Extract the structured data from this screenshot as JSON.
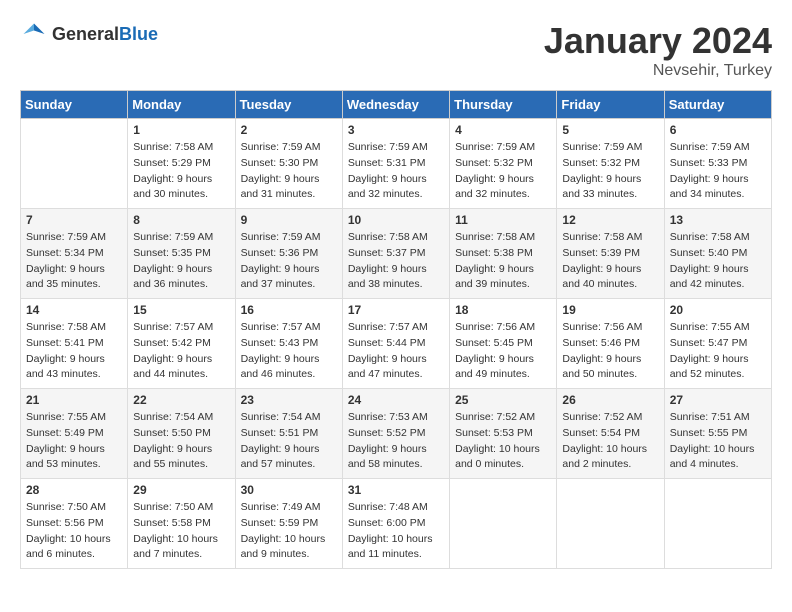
{
  "logo": {
    "general": "General",
    "blue": "Blue"
  },
  "header": {
    "month": "January 2024",
    "location": "Nevsehir, Turkey"
  },
  "weekdays": [
    "Sunday",
    "Monday",
    "Tuesday",
    "Wednesday",
    "Thursday",
    "Friday",
    "Saturday"
  ],
  "weeks": [
    [
      {
        "day": "",
        "sunrise": "",
        "sunset": "",
        "daylight": ""
      },
      {
        "day": "1",
        "sunrise": "Sunrise: 7:58 AM",
        "sunset": "Sunset: 5:29 PM",
        "daylight": "Daylight: 9 hours and 30 minutes."
      },
      {
        "day": "2",
        "sunrise": "Sunrise: 7:59 AM",
        "sunset": "Sunset: 5:30 PM",
        "daylight": "Daylight: 9 hours and 31 minutes."
      },
      {
        "day": "3",
        "sunrise": "Sunrise: 7:59 AM",
        "sunset": "Sunset: 5:31 PM",
        "daylight": "Daylight: 9 hours and 32 minutes."
      },
      {
        "day": "4",
        "sunrise": "Sunrise: 7:59 AM",
        "sunset": "Sunset: 5:32 PM",
        "daylight": "Daylight: 9 hours and 32 minutes."
      },
      {
        "day": "5",
        "sunrise": "Sunrise: 7:59 AM",
        "sunset": "Sunset: 5:32 PM",
        "daylight": "Daylight: 9 hours and 33 minutes."
      },
      {
        "day": "6",
        "sunrise": "Sunrise: 7:59 AM",
        "sunset": "Sunset: 5:33 PM",
        "daylight": "Daylight: 9 hours and 34 minutes."
      }
    ],
    [
      {
        "day": "7",
        "sunrise": "Sunrise: 7:59 AM",
        "sunset": "Sunset: 5:34 PM",
        "daylight": "Daylight: 9 hours and 35 minutes."
      },
      {
        "day": "8",
        "sunrise": "Sunrise: 7:59 AM",
        "sunset": "Sunset: 5:35 PM",
        "daylight": "Daylight: 9 hours and 36 minutes."
      },
      {
        "day": "9",
        "sunrise": "Sunrise: 7:59 AM",
        "sunset": "Sunset: 5:36 PM",
        "daylight": "Daylight: 9 hours and 37 minutes."
      },
      {
        "day": "10",
        "sunrise": "Sunrise: 7:58 AM",
        "sunset": "Sunset: 5:37 PM",
        "daylight": "Daylight: 9 hours and 38 minutes."
      },
      {
        "day": "11",
        "sunrise": "Sunrise: 7:58 AM",
        "sunset": "Sunset: 5:38 PM",
        "daylight": "Daylight: 9 hours and 39 minutes."
      },
      {
        "day": "12",
        "sunrise": "Sunrise: 7:58 AM",
        "sunset": "Sunset: 5:39 PM",
        "daylight": "Daylight: 9 hours and 40 minutes."
      },
      {
        "day": "13",
        "sunrise": "Sunrise: 7:58 AM",
        "sunset": "Sunset: 5:40 PM",
        "daylight": "Daylight: 9 hours and 42 minutes."
      }
    ],
    [
      {
        "day": "14",
        "sunrise": "Sunrise: 7:58 AM",
        "sunset": "Sunset: 5:41 PM",
        "daylight": "Daylight: 9 hours and 43 minutes."
      },
      {
        "day": "15",
        "sunrise": "Sunrise: 7:57 AM",
        "sunset": "Sunset: 5:42 PM",
        "daylight": "Daylight: 9 hours and 44 minutes."
      },
      {
        "day": "16",
        "sunrise": "Sunrise: 7:57 AM",
        "sunset": "Sunset: 5:43 PM",
        "daylight": "Daylight: 9 hours and 46 minutes."
      },
      {
        "day": "17",
        "sunrise": "Sunrise: 7:57 AM",
        "sunset": "Sunset: 5:44 PM",
        "daylight": "Daylight: 9 hours and 47 minutes."
      },
      {
        "day": "18",
        "sunrise": "Sunrise: 7:56 AM",
        "sunset": "Sunset: 5:45 PM",
        "daylight": "Daylight: 9 hours and 49 minutes."
      },
      {
        "day": "19",
        "sunrise": "Sunrise: 7:56 AM",
        "sunset": "Sunset: 5:46 PM",
        "daylight": "Daylight: 9 hours and 50 minutes."
      },
      {
        "day": "20",
        "sunrise": "Sunrise: 7:55 AM",
        "sunset": "Sunset: 5:47 PM",
        "daylight": "Daylight: 9 hours and 52 minutes."
      }
    ],
    [
      {
        "day": "21",
        "sunrise": "Sunrise: 7:55 AM",
        "sunset": "Sunset: 5:49 PM",
        "daylight": "Daylight: 9 hours and 53 minutes."
      },
      {
        "day": "22",
        "sunrise": "Sunrise: 7:54 AM",
        "sunset": "Sunset: 5:50 PM",
        "daylight": "Daylight: 9 hours and 55 minutes."
      },
      {
        "day": "23",
        "sunrise": "Sunrise: 7:54 AM",
        "sunset": "Sunset: 5:51 PM",
        "daylight": "Daylight: 9 hours and 57 minutes."
      },
      {
        "day": "24",
        "sunrise": "Sunrise: 7:53 AM",
        "sunset": "Sunset: 5:52 PM",
        "daylight": "Daylight: 9 hours and 58 minutes."
      },
      {
        "day": "25",
        "sunrise": "Sunrise: 7:52 AM",
        "sunset": "Sunset: 5:53 PM",
        "daylight": "Daylight: 10 hours and 0 minutes."
      },
      {
        "day": "26",
        "sunrise": "Sunrise: 7:52 AM",
        "sunset": "Sunset: 5:54 PM",
        "daylight": "Daylight: 10 hours and 2 minutes."
      },
      {
        "day": "27",
        "sunrise": "Sunrise: 7:51 AM",
        "sunset": "Sunset: 5:55 PM",
        "daylight": "Daylight: 10 hours and 4 minutes."
      }
    ],
    [
      {
        "day": "28",
        "sunrise": "Sunrise: 7:50 AM",
        "sunset": "Sunset: 5:56 PM",
        "daylight": "Daylight: 10 hours and 6 minutes."
      },
      {
        "day": "29",
        "sunrise": "Sunrise: 7:50 AM",
        "sunset": "Sunset: 5:58 PM",
        "daylight": "Daylight: 10 hours and 7 minutes."
      },
      {
        "day": "30",
        "sunrise": "Sunrise: 7:49 AM",
        "sunset": "Sunset: 5:59 PM",
        "daylight": "Daylight: 10 hours and 9 minutes."
      },
      {
        "day": "31",
        "sunrise": "Sunrise: 7:48 AM",
        "sunset": "Sunset: 6:00 PM",
        "daylight": "Daylight: 10 hours and 11 minutes."
      },
      {
        "day": "",
        "sunrise": "",
        "sunset": "",
        "daylight": ""
      },
      {
        "day": "",
        "sunrise": "",
        "sunset": "",
        "daylight": ""
      },
      {
        "day": "",
        "sunrise": "",
        "sunset": "",
        "daylight": ""
      }
    ]
  ]
}
